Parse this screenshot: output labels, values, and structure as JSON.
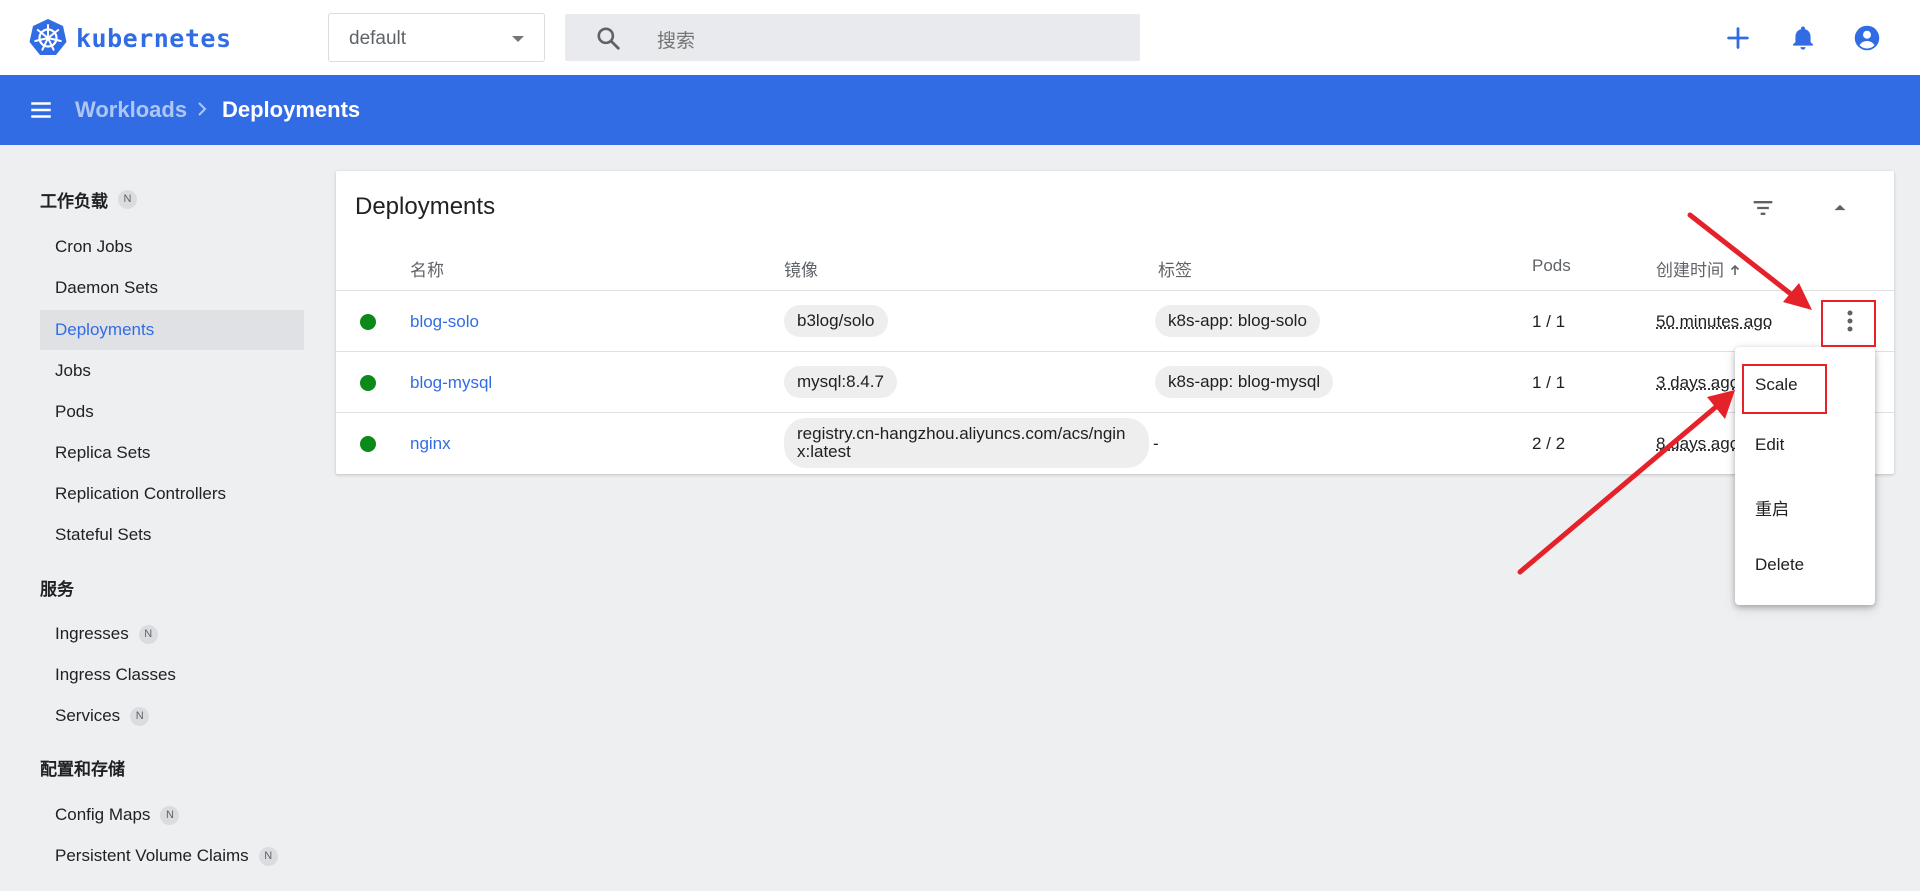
{
  "header": {
    "brand": "kubernetes",
    "namespace": "default",
    "search_placeholder": "搜索"
  },
  "appbar": {
    "breadcrumb_parent": "Workloads",
    "breadcrumb_current": "Deployments"
  },
  "sidebar": {
    "sections": [
      {
        "title": "工作负载",
        "badge": "N"
      },
      {
        "title": "服务"
      },
      {
        "title": "配置和存储"
      }
    ],
    "items": [
      {
        "label": "Cron Jobs"
      },
      {
        "label": "Daemon Sets"
      },
      {
        "label": "Deployments",
        "active": true
      },
      {
        "label": "Jobs"
      },
      {
        "label": "Pods"
      },
      {
        "label": "Replica Sets"
      },
      {
        "label": "Replication Controllers"
      },
      {
        "label": "Stateful Sets"
      },
      {
        "label": "Ingresses",
        "badge": "N"
      },
      {
        "label": "Ingress Classes"
      },
      {
        "label": "Services",
        "badge": "N"
      },
      {
        "label": "Config Maps",
        "badge": "N"
      },
      {
        "label": "Persistent Volume Claims",
        "badge": "N"
      }
    ]
  },
  "card": {
    "title": "Deployments",
    "columns": [
      "名称",
      "镜像",
      "标签",
      "Pods",
      "创建时间"
    ],
    "rows": [
      {
        "status": "running",
        "name": "blog-solo",
        "image": "b3log/solo",
        "label": "k8s-app: blog-solo",
        "pods": "1 / 1",
        "created": "50 minutes ago"
      },
      {
        "status": "running",
        "name": "blog-mysql",
        "image": "mysql:8.4.7",
        "label": "k8s-app: blog-mysql",
        "pods": "1 / 1",
        "created": "3 days ago"
      },
      {
        "status": "running",
        "name": "nginx",
        "image": "registry.cn-hangzhou.aliyuncs.com/acs/nginx:latest",
        "label": "-",
        "pods": "2 / 2",
        "created": "8 days ago"
      }
    ]
  },
  "action_menu": {
    "items": [
      "Scale",
      "Edit",
      "重启",
      "Delete"
    ]
  },
  "colors": {
    "brand_blue": "#326ce5",
    "status_green": "#0b8a19",
    "annotation_red": "#e5212a"
  }
}
